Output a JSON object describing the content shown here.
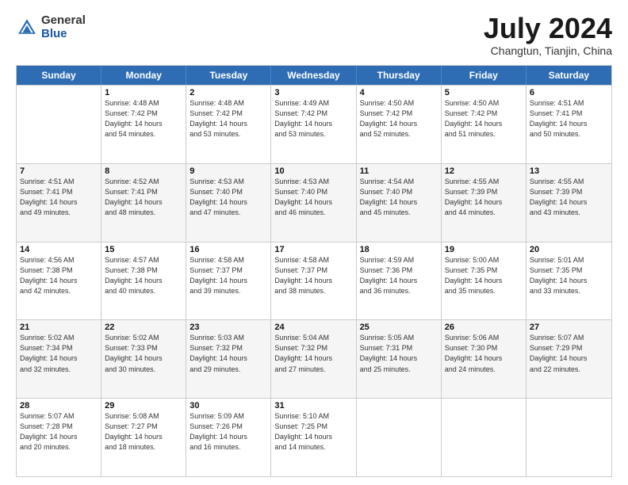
{
  "header": {
    "logo": {
      "general": "General",
      "blue": "Blue"
    },
    "title": "July 2024",
    "location": "Changtun, Tianjin, China"
  },
  "weekdays": [
    "Sunday",
    "Monday",
    "Tuesday",
    "Wednesday",
    "Thursday",
    "Friday",
    "Saturday"
  ],
  "rows": [
    [
      {
        "day": "",
        "empty": true,
        "shaded": false
      },
      {
        "day": "1",
        "sunrise": "Sunrise: 4:48 AM",
        "sunset": "Sunset: 7:42 PM",
        "daylight": "Daylight: 14 hours",
        "minutes": "and 54 minutes.",
        "shaded": false
      },
      {
        "day": "2",
        "sunrise": "Sunrise: 4:48 AM",
        "sunset": "Sunset: 7:42 PM",
        "daylight": "Daylight: 14 hours",
        "minutes": "and 53 minutes.",
        "shaded": false
      },
      {
        "day": "3",
        "sunrise": "Sunrise: 4:49 AM",
        "sunset": "Sunset: 7:42 PM",
        "daylight": "Daylight: 14 hours",
        "minutes": "and 53 minutes.",
        "shaded": false
      },
      {
        "day": "4",
        "sunrise": "Sunrise: 4:50 AM",
        "sunset": "Sunset: 7:42 PM",
        "daylight": "Daylight: 14 hours",
        "minutes": "and 52 minutes.",
        "shaded": false
      },
      {
        "day": "5",
        "sunrise": "Sunrise: 4:50 AM",
        "sunset": "Sunset: 7:42 PM",
        "daylight": "Daylight: 14 hours",
        "minutes": "and 51 minutes.",
        "shaded": false
      },
      {
        "day": "6",
        "sunrise": "Sunrise: 4:51 AM",
        "sunset": "Sunset: 7:41 PM",
        "daylight": "Daylight: 14 hours",
        "minutes": "and 50 minutes.",
        "shaded": false
      }
    ],
    [
      {
        "day": "7",
        "sunrise": "Sunrise: 4:51 AM",
        "sunset": "Sunset: 7:41 PM",
        "daylight": "Daylight: 14 hours",
        "minutes": "and 49 minutes.",
        "shaded": true
      },
      {
        "day": "8",
        "sunrise": "Sunrise: 4:52 AM",
        "sunset": "Sunset: 7:41 PM",
        "daylight": "Daylight: 14 hours",
        "minutes": "and 48 minutes.",
        "shaded": true
      },
      {
        "day": "9",
        "sunrise": "Sunrise: 4:53 AM",
        "sunset": "Sunset: 7:40 PM",
        "daylight": "Daylight: 14 hours",
        "minutes": "and 47 minutes.",
        "shaded": true
      },
      {
        "day": "10",
        "sunrise": "Sunrise: 4:53 AM",
        "sunset": "Sunset: 7:40 PM",
        "daylight": "Daylight: 14 hours",
        "minutes": "and 46 minutes.",
        "shaded": true
      },
      {
        "day": "11",
        "sunrise": "Sunrise: 4:54 AM",
        "sunset": "Sunset: 7:40 PM",
        "daylight": "Daylight: 14 hours",
        "minutes": "and 45 minutes.",
        "shaded": true
      },
      {
        "day": "12",
        "sunrise": "Sunrise: 4:55 AM",
        "sunset": "Sunset: 7:39 PM",
        "daylight": "Daylight: 14 hours",
        "minutes": "and 44 minutes.",
        "shaded": true
      },
      {
        "day": "13",
        "sunrise": "Sunrise: 4:55 AM",
        "sunset": "Sunset: 7:39 PM",
        "daylight": "Daylight: 14 hours",
        "minutes": "and 43 minutes.",
        "shaded": true
      }
    ],
    [
      {
        "day": "14",
        "sunrise": "Sunrise: 4:56 AM",
        "sunset": "Sunset: 7:38 PM",
        "daylight": "Daylight: 14 hours",
        "minutes": "and 42 minutes.",
        "shaded": false
      },
      {
        "day": "15",
        "sunrise": "Sunrise: 4:57 AM",
        "sunset": "Sunset: 7:38 PM",
        "daylight": "Daylight: 14 hours",
        "minutes": "and 40 minutes.",
        "shaded": false
      },
      {
        "day": "16",
        "sunrise": "Sunrise: 4:58 AM",
        "sunset": "Sunset: 7:37 PM",
        "daylight": "Daylight: 14 hours",
        "minutes": "and 39 minutes.",
        "shaded": false
      },
      {
        "day": "17",
        "sunrise": "Sunrise: 4:58 AM",
        "sunset": "Sunset: 7:37 PM",
        "daylight": "Daylight: 14 hours",
        "minutes": "and 38 minutes.",
        "shaded": false
      },
      {
        "day": "18",
        "sunrise": "Sunrise: 4:59 AM",
        "sunset": "Sunset: 7:36 PM",
        "daylight": "Daylight: 14 hours",
        "minutes": "and 36 minutes.",
        "shaded": false
      },
      {
        "day": "19",
        "sunrise": "Sunrise: 5:00 AM",
        "sunset": "Sunset: 7:35 PM",
        "daylight": "Daylight: 14 hours",
        "minutes": "and 35 minutes.",
        "shaded": false
      },
      {
        "day": "20",
        "sunrise": "Sunrise: 5:01 AM",
        "sunset": "Sunset: 7:35 PM",
        "daylight": "Daylight: 14 hours",
        "minutes": "and 33 minutes.",
        "shaded": false
      }
    ],
    [
      {
        "day": "21",
        "sunrise": "Sunrise: 5:02 AM",
        "sunset": "Sunset: 7:34 PM",
        "daylight": "Daylight: 14 hours",
        "minutes": "and 32 minutes.",
        "shaded": true
      },
      {
        "day": "22",
        "sunrise": "Sunrise: 5:02 AM",
        "sunset": "Sunset: 7:33 PM",
        "daylight": "Daylight: 14 hours",
        "minutes": "and 30 minutes.",
        "shaded": true
      },
      {
        "day": "23",
        "sunrise": "Sunrise: 5:03 AM",
        "sunset": "Sunset: 7:32 PM",
        "daylight": "Daylight: 14 hours",
        "minutes": "and 29 minutes.",
        "shaded": true
      },
      {
        "day": "24",
        "sunrise": "Sunrise: 5:04 AM",
        "sunset": "Sunset: 7:32 PM",
        "daylight": "Daylight: 14 hours",
        "minutes": "and 27 minutes.",
        "shaded": true
      },
      {
        "day": "25",
        "sunrise": "Sunrise: 5:05 AM",
        "sunset": "Sunset: 7:31 PM",
        "daylight": "Daylight: 14 hours",
        "minutes": "and 25 minutes.",
        "shaded": true
      },
      {
        "day": "26",
        "sunrise": "Sunrise: 5:06 AM",
        "sunset": "Sunset: 7:30 PM",
        "daylight": "Daylight: 14 hours",
        "minutes": "and 24 minutes.",
        "shaded": true
      },
      {
        "day": "27",
        "sunrise": "Sunrise: 5:07 AM",
        "sunset": "Sunset: 7:29 PM",
        "daylight": "Daylight: 14 hours",
        "minutes": "and 22 minutes.",
        "shaded": true
      }
    ],
    [
      {
        "day": "28",
        "sunrise": "Sunrise: 5:07 AM",
        "sunset": "Sunset: 7:28 PM",
        "daylight": "Daylight: 14 hours",
        "minutes": "and 20 minutes.",
        "shaded": false
      },
      {
        "day": "29",
        "sunrise": "Sunrise: 5:08 AM",
        "sunset": "Sunset: 7:27 PM",
        "daylight": "Daylight: 14 hours",
        "minutes": "and 18 minutes.",
        "shaded": false
      },
      {
        "day": "30",
        "sunrise": "Sunrise: 5:09 AM",
        "sunset": "Sunset: 7:26 PM",
        "daylight": "Daylight: 14 hours",
        "minutes": "and 16 minutes.",
        "shaded": false
      },
      {
        "day": "31",
        "sunrise": "Sunrise: 5:10 AM",
        "sunset": "Sunset: 7:25 PM",
        "daylight": "Daylight: 14 hours",
        "minutes": "and 14 minutes.",
        "shaded": false
      },
      {
        "day": "",
        "empty": true,
        "shaded": false
      },
      {
        "day": "",
        "empty": true,
        "shaded": false
      },
      {
        "day": "",
        "empty": true,
        "shaded": false
      }
    ]
  ]
}
